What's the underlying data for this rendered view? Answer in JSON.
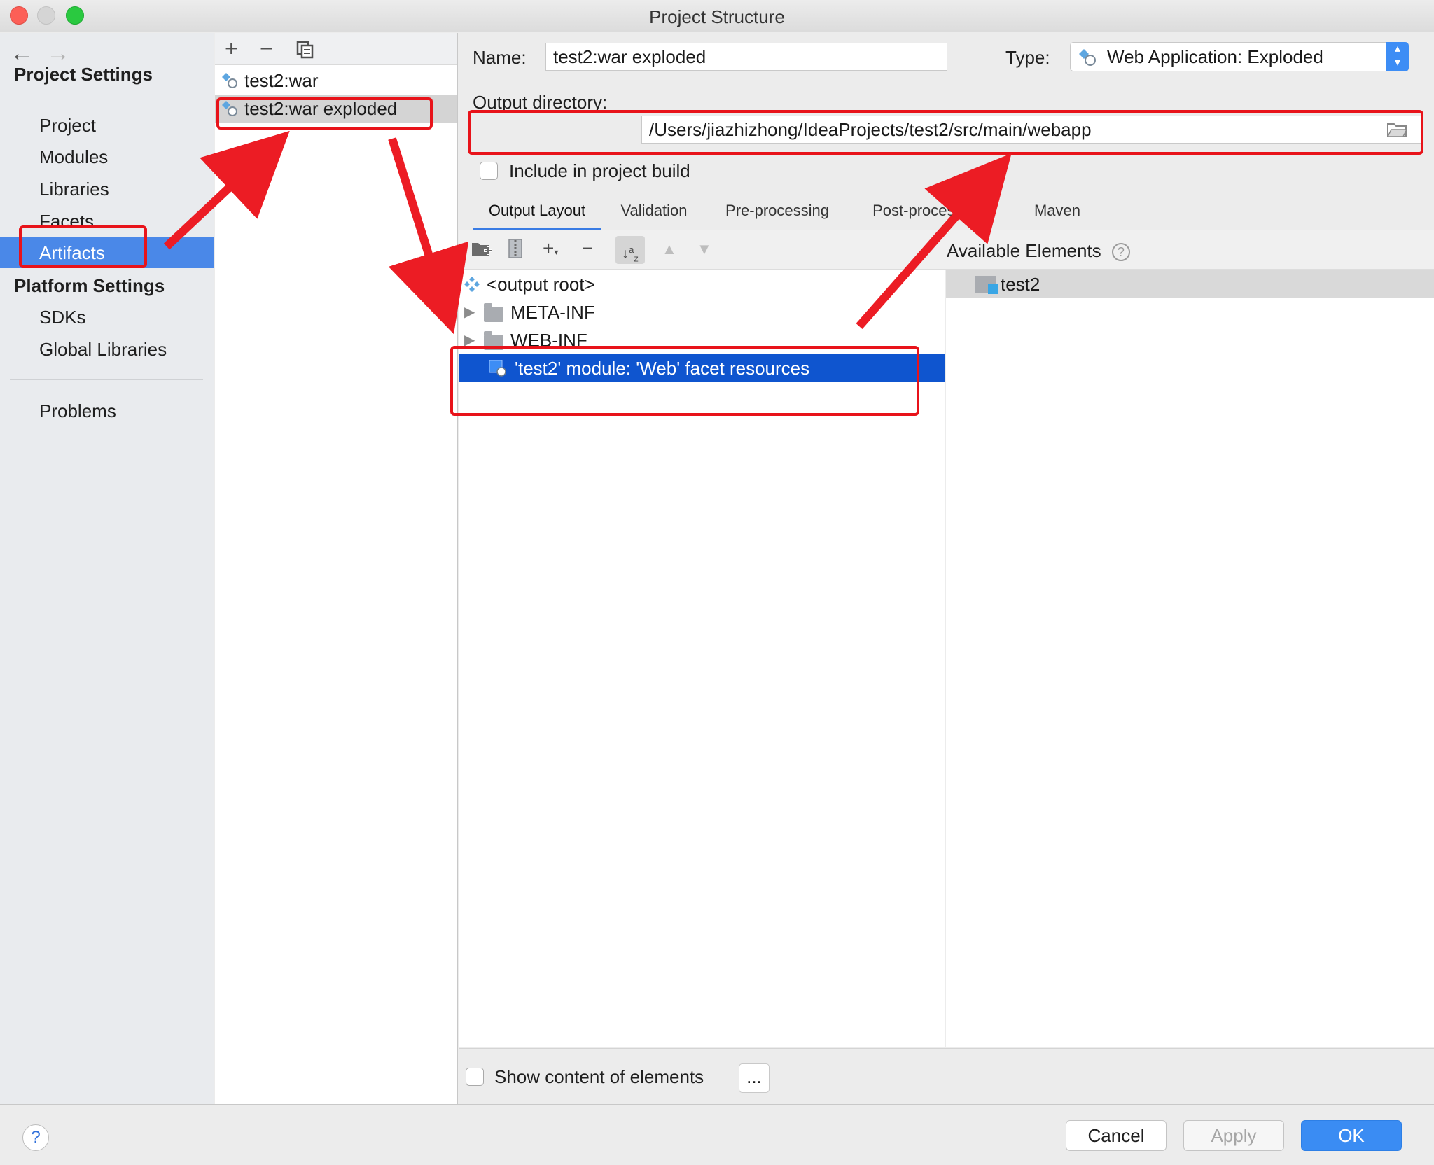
{
  "window": {
    "title": "Project Structure"
  },
  "nav": {
    "project_settings_header": "Project Settings",
    "platform_settings_header": "Platform Settings",
    "items": {
      "project": "Project",
      "modules": "Modules",
      "libraries": "Libraries",
      "facets": "Facets",
      "artifacts": "Artifacts",
      "sdks": "SDKs",
      "global_libraries": "Global Libraries",
      "problems": "Problems"
    }
  },
  "artifacts": {
    "items": [
      "test2:war",
      "test2:war exploded"
    ],
    "selected": "test2:war exploded"
  },
  "editor": {
    "name_label": "Name:",
    "name_value": "test2:war exploded",
    "type_label": "Type:",
    "type_value": "Web Application: Exploded",
    "output_dir_label": "Output directory:",
    "output_dir_value": "/Users/jiazhizhong/IdeaProjects/test2/src/main/webapp",
    "include_build_label": "Include in project build",
    "tabs": [
      "Output Layout",
      "Validation",
      "Pre-processing",
      "Post-processing",
      "Maven"
    ],
    "selected_tab": "Output Layout",
    "tree": {
      "root": "<output root>",
      "meta_inf": "META-INF",
      "web_inf": "WEB-INF",
      "facet_resources": "'test2' module: 'Web' facet resources"
    },
    "available_elements_title": "Available Elements",
    "available_items": [
      "test2"
    ],
    "show_content_label": "Show content of elements",
    "dots_label": "..."
  },
  "footer": {
    "help": "?",
    "cancel": "Cancel",
    "apply": "Apply",
    "ok": "OK"
  },
  "colors": {
    "selection_blue": "#4a88e8",
    "tree_selection": "#0f55cf",
    "annotation_red": "#e8131a",
    "ok_blue": "#3a8cf3"
  }
}
